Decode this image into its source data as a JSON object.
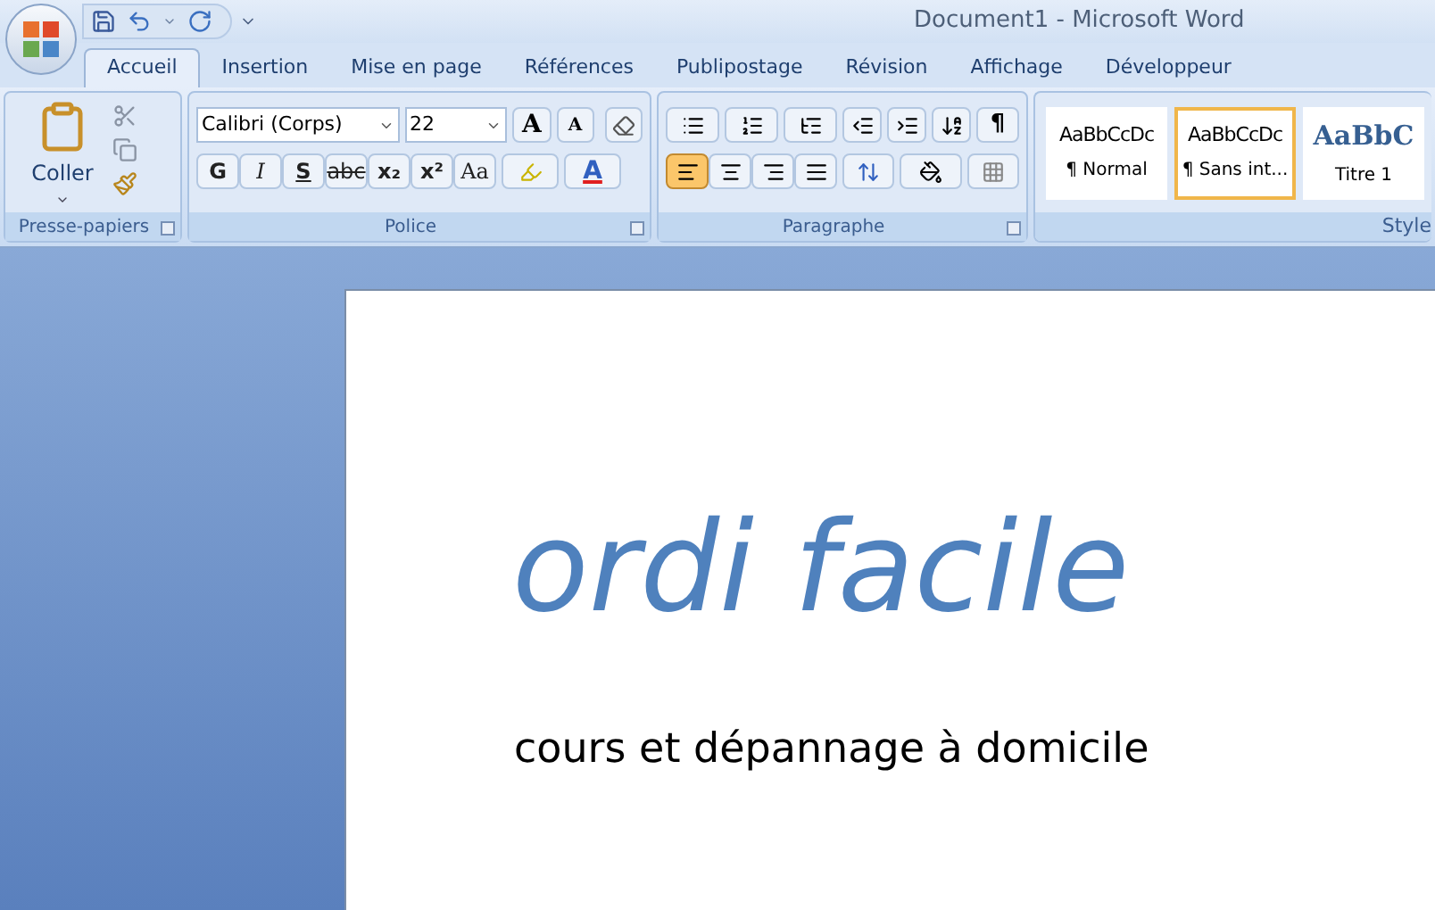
{
  "window": {
    "title": "Document1 - Microsoft Word"
  },
  "tabs": [
    {
      "label": "Accueil",
      "selected": true
    },
    {
      "label": "Insertion",
      "selected": false
    },
    {
      "label": "Mise en page",
      "selected": false
    },
    {
      "label": "Références",
      "selected": false
    },
    {
      "label": "Publipostage",
      "selected": false
    },
    {
      "label": "Révision",
      "selected": false
    },
    {
      "label": "Affichage",
      "selected": false
    },
    {
      "label": "Développeur",
      "selected": false
    }
  ],
  "clipboard": {
    "label": "Presse-papiers",
    "paste": "Coller"
  },
  "font": {
    "label": "Police",
    "family": "Calibri (Corps)",
    "size": "22",
    "grow": "A",
    "shrink": "A",
    "format_buttons": [
      {
        "label": "G",
        "kind": "bold"
      },
      {
        "label": "I",
        "kind": "italic"
      },
      {
        "label": "S",
        "kind": "underline"
      },
      {
        "label": "abc",
        "kind": "strike"
      },
      {
        "label": "x₂",
        "kind": "sub"
      },
      {
        "label": "x²",
        "kind": "sup"
      },
      {
        "label": "Aa",
        "kind": "case"
      }
    ],
    "color_label": "A"
  },
  "paragraph": {
    "label": "Paragraphe",
    "pilcrow": "¶",
    "alignments": [
      {
        "kind": "left",
        "selected": true
      },
      {
        "kind": "center",
        "selected": false
      },
      {
        "kind": "right",
        "selected": false
      },
      {
        "kind": "justify",
        "selected": false
      }
    ]
  },
  "styles": {
    "label": "Style",
    "items": [
      {
        "preview": "AaBbCcDc",
        "name": "¶ Normal",
        "kind": "body",
        "selected": false
      },
      {
        "preview": "AaBbCcDc",
        "name": "¶ Sans int...",
        "kind": "body",
        "selected": true
      },
      {
        "preview": "AaBbC",
        "name": "Titre 1",
        "kind": "heading",
        "selected": false
      }
    ]
  },
  "document": {
    "title": "ordi facile",
    "subtitle": "cours et dépannage à domicile"
  }
}
